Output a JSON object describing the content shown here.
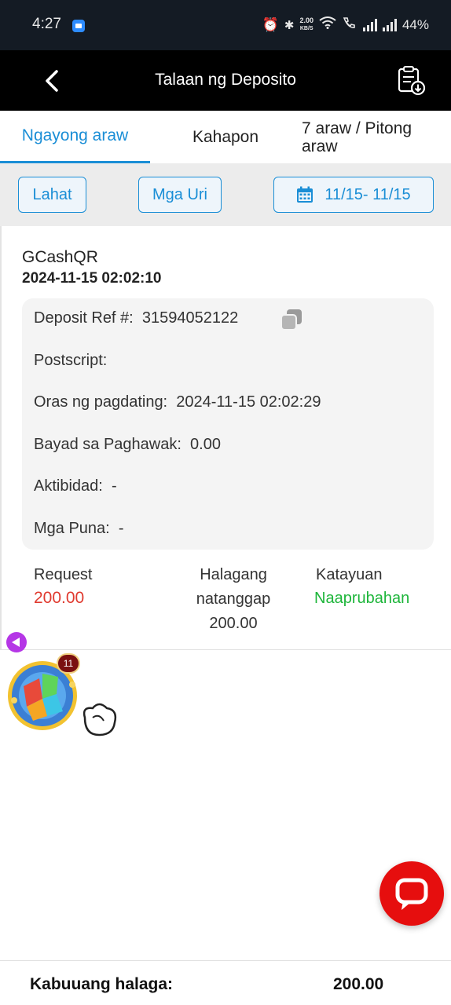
{
  "status_bar": {
    "time": "4:27",
    "net_speed_value": "2.00",
    "net_speed_unit": "KB/S",
    "battery": "44%"
  },
  "header": {
    "title": "Talaan ng Deposito"
  },
  "tabs": [
    {
      "label": "Ngayong araw",
      "active": true
    },
    {
      "label": "Kahapon",
      "active": false
    },
    {
      "label": "7 araw / Pitong araw",
      "active": false
    }
  ],
  "filters": {
    "all_label": "Lahat",
    "types_label": "Mga Uri",
    "date_range": "11/15- 11/15"
  },
  "record": {
    "channel": "GCashQR",
    "datetime": "2024-11-15 02:02:10",
    "details": [
      {
        "label": "Deposit Ref #:",
        "value": "31594052122"
      },
      {
        "label": "Postscript:",
        "value": ""
      },
      {
        "label": "Oras ng pagdating:",
        "value": "2024-11-15 02:02:29"
      },
      {
        "label": "Bayad sa Paghawak:",
        "value": "0.00"
      },
      {
        "label": "Aktibidad:",
        "value": "-"
      },
      {
        "label": "Mga Puna:",
        "value": "-"
      }
    ],
    "request_label": "Request",
    "request_value": "200.00",
    "received_label_line1": "Halagang",
    "received_label_line2": "natanggap",
    "received_value": "200.00",
    "status_label": "Katayuan",
    "status_value": "Naaprubahan"
  },
  "game_widget": {
    "badge_count": "11"
  },
  "footer": {
    "total_label": "Kabuuang halaga:",
    "total_value": "200.00"
  },
  "colors": {
    "accent": "#1a8ed6",
    "request_red": "#e03a2f",
    "approved_green": "#1db53a",
    "chat_red": "#e60e0e"
  }
}
